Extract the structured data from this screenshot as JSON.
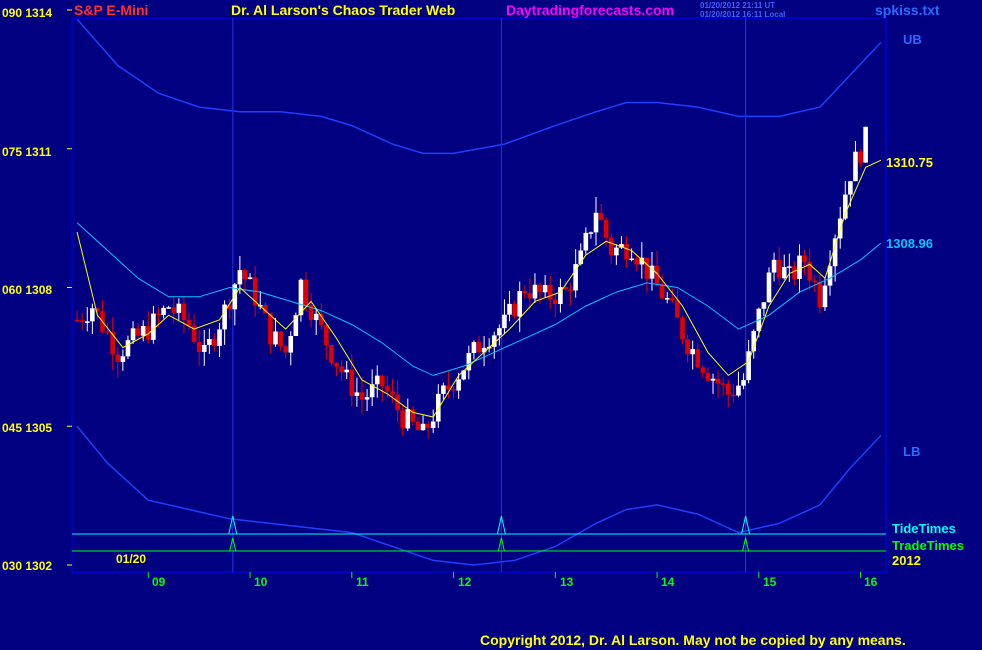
{
  "header": {
    "symbol": "S&P E-Mini",
    "title": "Dr. Al Larson's Chaos Trader Web",
    "site": "Daytradingforecasts.com",
    "stamp1": "01/20/2012 21:11 UT",
    "stamp2": "01/20/2012 16:11 Local",
    "file": "spkiss.txt"
  },
  "footer": {
    "copyright": "Copyright 2012, Dr. Al Larson. May not be copied by any means."
  },
  "colors": {
    "background": "#000080",
    "frame": "#0000ff",
    "bands": "#1f3fff",
    "up_candle": "#ffffff",
    "down_candle": "#e00000",
    "ema_fast": "#ffff00",
    "ema_slow": "#00c8ff",
    "tide": "#00ffff",
    "trade": "#00ff00",
    "symbol": "#ff3030",
    "title": "#ffff00",
    "site": "#ff00ff",
    "file": "#2a6cff"
  },
  "chart_data": {
    "type": "candlestick",
    "y_axis_left_labels": [
      "090 1314",
      "075 1311",
      "060 1308",
      "045 1305",
      "030 1302"
    ],
    "y_axis_left": [
      {
        "pct": 90,
        "price": 1314
      },
      {
        "pct": 75,
        "price": 1311
      },
      {
        "pct": 60,
        "price": 1308
      },
      {
        "pct": 45,
        "price": 1305
      },
      {
        "pct": 30,
        "price": 1302
      }
    ],
    "ylim": [
      1302,
      1314
    ],
    "x_tick_labels": [
      "09",
      "10",
      "11",
      "12",
      "13",
      "14",
      "15",
      "16"
    ],
    "x_ticks": [
      9,
      10,
      11,
      12,
      13,
      14,
      15,
      16
    ],
    "xlim": [
      8.25,
      16.25
    ],
    "date_label": "01/20",
    "year_label": "2012",
    "band_labels": {
      "upper": "UB",
      "lower": "LB"
    },
    "price_labels": {
      "fast": "1310.75",
      "slow": "1308.96"
    },
    "legend": [
      {
        "name": "TideTimes",
        "color": "#00ffff"
      },
      {
        "name": "TradeTimes",
        "color": "#00ff00"
      }
    ],
    "close_path": [
      [
        8.3,
        1307.3
      ],
      [
        8.45,
        1307.6
      ],
      [
        8.7,
        1306.6
      ],
      [
        9.0,
        1307.1
      ],
      [
        9.2,
        1307.6
      ],
      [
        9.4,
        1307.2
      ],
      [
        9.55,
        1306.5
      ],
      [
        9.75,
        1307.5
      ],
      [
        9.9,
        1308.4
      ],
      [
        10.05,
        1307.8
      ],
      [
        10.2,
        1307.0
      ],
      [
        10.35,
        1306.6
      ],
      [
        10.5,
        1308.1
      ],
      [
        10.65,
        1307.3
      ],
      [
        10.8,
        1306.6
      ],
      [
        10.95,
        1306.0
      ],
      [
        11.1,
        1305.6
      ],
      [
        11.3,
        1305.9
      ],
      [
        11.5,
        1305.2
      ],
      [
        11.7,
        1304.8
      ],
      [
        11.9,
        1305.7
      ],
      [
        12.1,
        1306.3
      ],
      [
        12.3,
        1306.9
      ],
      [
        12.5,
        1307.2
      ],
      [
        12.7,
        1308.0
      ],
      [
        12.9,
        1307.8
      ],
      [
        13.1,
        1307.9
      ],
      [
        13.25,
        1308.6
      ],
      [
        13.4,
        1309.7
      ],
      [
        13.55,
        1308.8
      ],
      [
        13.75,
        1308.9
      ],
      [
        13.95,
        1308.2
      ],
      [
        14.1,
        1307.7
      ],
      [
        14.3,
        1306.8
      ],
      [
        14.5,
        1306.2
      ],
      [
        14.7,
        1305.7
      ],
      [
        14.85,
        1306.0
      ],
      [
        15.0,
        1307.4
      ],
      [
        15.15,
        1308.6
      ],
      [
        15.3,
        1308.2
      ],
      [
        15.45,
        1308.6
      ],
      [
        15.6,
        1307.8
      ],
      [
        15.75,
        1309.2
      ],
      [
        15.9,
        1310.5
      ],
      [
        16.05,
        1311.2
      ]
    ],
    "ema_fast": [
      [
        8.3,
        1309.2
      ],
      [
        8.5,
        1307.4
      ],
      [
        8.75,
        1306.7
      ],
      [
        9.0,
        1307.0
      ],
      [
        9.2,
        1307.4
      ],
      [
        9.45,
        1307.1
      ],
      [
        9.7,
        1307.3
      ],
      [
        9.9,
        1308.0
      ],
      [
        10.1,
        1307.6
      ],
      [
        10.35,
        1307.1
      ],
      [
        10.6,
        1307.7
      ],
      [
        10.85,
        1306.9
      ],
      [
        11.1,
        1306.0
      ],
      [
        11.35,
        1305.7
      ],
      [
        11.6,
        1305.3
      ],
      [
        11.8,
        1305.2
      ],
      [
        12.05,
        1306.1
      ],
      [
        12.3,
        1306.6
      ],
      [
        12.55,
        1307.1
      ],
      [
        12.8,
        1307.7
      ],
      [
        13.05,
        1307.9
      ],
      [
        13.3,
        1308.7
      ],
      [
        13.5,
        1309.0
      ],
      [
        13.75,
        1308.8
      ],
      [
        14.0,
        1308.3
      ],
      [
        14.25,
        1307.6
      ],
      [
        14.5,
        1306.6
      ],
      [
        14.7,
        1306.1
      ],
      [
        14.9,
        1306.4
      ],
      [
        15.1,
        1307.6
      ],
      [
        15.3,
        1308.3
      ],
      [
        15.5,
        1308.5
      ],
      [
        15.65,
        1308.2
      ],
      [
        15.85,
        1309.6
      ],
      [
        16.05,
        1310.6
      ],
      [
        16.2,
        1310.75
      ]
    ],
    "ema_slow": [
      [
        8.3,
        1309.4
      ],
      [
        8.6,
        1308.8
      ],
      [
        8.9,
        1308.2
      ],
      [
        9.2,
        1307.8
      ],
      [
        9.5,
        1307.8
      ],
      [
        9.8,
        1308.0
      ],
      [
        10.1,
        1307.9
      ],
      [
        10.4,
        1307.7
      ],
      [
        10.7,
        1307.5
      ],
      [
        11.0,
        1307.2
      ],
      [
        11.3,
        1306.8
      ],
      [
        11.6,
        1306.3
      ],
      [
        11.8,
        1306.1
      ],
      [
        12.1,
        1306.3
      ],
      [
        12.4,
        1306.6
      ],
      [
        12.7,
        1306.9
      ],
      [
        13.0,
        1307.2
      ],
      [
        13.3,
        1307.6
      ],
      [
        13.6,
        1307.9
      ],
      [
        13.9,
        1308.1
      ],
      [
        14.2,
        1308.0
      ],
      [
        14.5,
        1307.6
      ],
      [
        14.8,
        1307.1
      ],
      [
        15.1,
        1307.4
      ],
      [
        15.4,
        1307.9
      ],
      [
        15.7,
        1308.2
      ],
      [
        16.0,
        1308.6
      ],
      [
        16.2,
        1308.96
      ]
    ],
    "upper_band": [
      [
        8.3,
        1313.8
      ],
      [
        8.7,
        1312.8
      ],
      [
        9.1,
        1312.2
      ],
      [
        9.5,
        1311.9
      ],
      [
        9.9,
        1311.8
      ],
      [
        10.3,
        1311.8
      ],
      [
        10.7,
        1311.7
      ],
      [
        11.0,
        1311.5
      ],
      [
        11.4,
        1311.1
      ],
      [
        11.7,
        1310.9
      ],
      [
        12.0,
        1310.9
      ],
      [
        12.5,
        1311.1
      ],
      [
        13.0,
        1311.5
      ],
      [
        13.4,
        1311.8
      ],
      [
        13.7,
        1312.0
      ],
      [
        14.0,
        1312.0
      ],
      [
        14.4,
        1311.9
      ],
      [
        14.8,
        1311.7
      ],
      [
        15.2,
        1311.7
      ],
      [
        15.6,
        1311.9
      ],
      [
        15.9,
        1312.6
      ],
      [
        16.2,
        1313.3
      ]
    ],
    "lower_band": [
      [
        8.3,
        1305.0
      ],
      [
        8.6,
        1304.2
      ],
      [
        9.0,
        1303.4
      ],
      [
        9.4,
        1303.2
      ],
      [
        9.8,
        1303.0
      ],
      [
        10.2,
        1302.9
      ],
      [
        10.6,
        1302.8
      ],
      [
        11.0,
        1302.7
      ],
      [
        11.4,
        1302.4
      ],
      [
        11.8,
        1302.1
      ],
      [
        12.2,
        1302.0
      ],
      [
        12.6,
        1302.1
      ],
      [
        13.0,
        1302.4
      ],
      [
        13.4,
        1302.9
      ],
      [
        13.7,
        1303.2
      ],
      [
        14.0,
        1303.3
      ],
      [
        14.4,
        1303.1
      ],
      [
        14.8,
        1302.7
      ],
      [
        15.2,
        1302.9
      ],
      [
        15.6,
        1303.3
      ],
      [
        15.9,
        1304.1
      ],
      [
        16.2,
        1304.8
      ]
    ],
    "tide_times": [
      9.83,
      12.47,
      14.87
    ]
  }
}
